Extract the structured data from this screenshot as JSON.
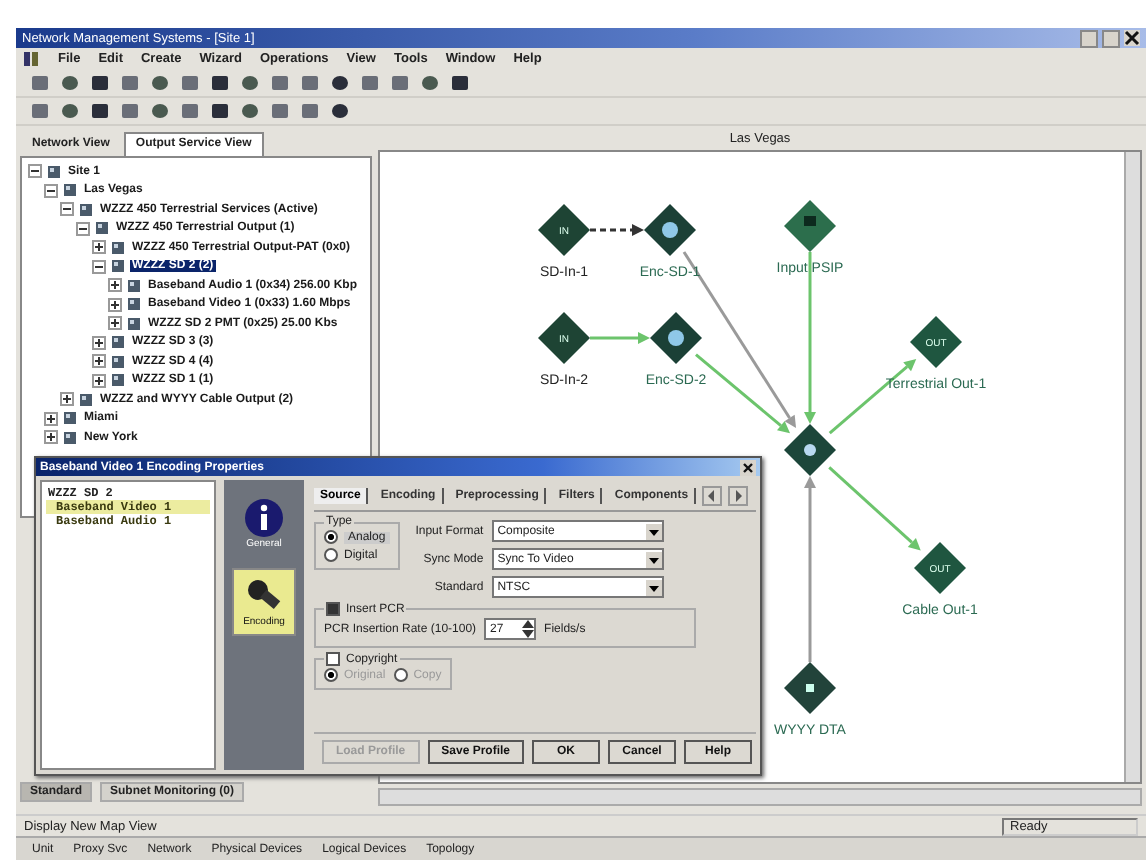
{
  "window": {
    "title": "Network Management Systems - [Site 1]"
  },
  "menu": [
    "File",
    "Edit",
    "Create",
    "Wizard",
    "Operations",
    "View",
    "Tools",
    "Window",
    "Help"
  ],
  "left_tabs": [
    {
      "label": "Network View",
      "selected": false
    },
    {
      "label": "Output Service View",
      "selected": true
    }
  ],
  "tree": [
    {
      "label": "Site 1",
      "expanded": true,
      "selected": false,
      "children": [
        {
          "label": "Las Vegas",
          "expanded": true,
          "selected": false,
          "children": [
            {
              "label": "WZZZ 450 Terrestrial Services (Active)",
              "expanded": true,
              "selected": false,
              "children": [
                {
                  "label": "WZZZ 450 Terrestrial Output (1)",
                  "expanded": true,
                  "selected": false,
                  "children": [
                    {
                      "label": "WZZZ 450 Terrestrial Output-PAT (0x0)",
                      "expanded": false,
                      "selected": false
                    },
                    {
                      "label": "WZZZ SD 2 (2)",
                      "expanded": true,
                      "selected": true,
                      "children": [
                        {
                          "label": "Baseband Audio 1 (0x34) 256.00 Kbp",
                          "expanded": false,
                          "selected": false
                        },
                        {
                          "label": "Baseband Video 1 (0x33) 1.60 Mbps",
                          "expanded": false,
                          "selected": false
                        },
                        {
                          "label": "WZZZ SD 2 PMT (0x25) 25.00 Kbs",
                          "expanded": false,
                          "selected": false
                        }
                      ]
                    },
                    {
                      "label": "WZZZ SD 3 (3)",
                      "expanded": false,
                      "selected": false
                    },
                    {
                      "label": "WZZZ SD 4 (4)",
                      "expanded": false,
                      "selected": false
                    },
                    {
                      "label": "WZZZ SD 1 (1)",
                      "expanded": false,
                      "selected": false
                    }
                  ]
                }
              ]
            },
            {
              "label": "WZZZ and WYYY Cable Output (2)",
              "expanded": false,
              "selected": false
            }
          ]
        },
        {
          "label": "Miami",
          "expanded": false,
          "selected": false
        },
        {
          "label": "New York",
          "expanded": false,
          "selected": false
        }
      ]
    }
  ],
  "left_bottom_tabs": [
    {
      "label": "Standard",
      "selected": true
    },
    {
      "label": "Subnet Monitoring (0)",
      "selected": false
    }
  ],
  "map": {
    "title": "Las Vegas",
    "nodes": [
      {
        "kind": "input",
        "label": "SD-In-1",
        "badge": "IN"
      },
      {
        "kind": "encoder",
        "label": "Enc-SD-1"
      },
      {
        "kind": "psip",
        "label": "Input PSIP"
      },
      {
        "kind": "input",
        "label": "SD-In-2",
        "badge": "IN"
      },
      {
        "kind": "encoder",
        "label": "Enc-SD-2"
      },
      {
        "kind": "output",
        "label": "Terrestrial Out-1",
        "badge": "OUT"
      },
      {
        "kind": "mux"
      },
      {
        "kind": "output",
        "label": "Cable Out-1",
        "badge": "OUT"
      },
      {
        "kind": "dta",
        "label": "WYYY DTA"
      }
    ],
    "links": [
      {
        "kind": "dashed"
      },
      {
        "kind": "inactive"
      },
      {
        "kind": "active"
      },
      {
        "kind": "active"
      },
      {
        "kind": "active"
      },
      {
        "kind": "active"
      },
      {
        "kind": "active"
      },
      {
        "kind": "inactive"
      }
    ]
  },
  "dialog": {
    "title": "Baseband Video 1 Encoding Properties",
    "items": [
      {
        "label": "WZZZ SD 2",
        "selected": false
      },
      {
        "label": "Baseband Video 1",
        "selected": true
      },
      {
        "label": "Baseband Audio 1",
        "selected": false
      }
    ],
    "sections": [
      {
        "kind": "info",
        "label": "General",
        "selected": false
      },
      {
        "kind": "encoding",
        "label": "Encoding",
        "selected": true
      }
    ],
    "tabs": [
      {
        "label": "Source",
        "selected": true
      },
      {
        "label": "Encoding",
        "selected": false
      },
      {
        "label": "Preprocessing",
        "selected": false
      },
      {
        "label": "Filters",
        "selected": false
      },
      {
        "label": "Components",
        "selected": false
      }
    ],
    "type_group": {
      "label": "Type",
      "options": [
        {
          "label": "Analog",
          "selected": true
        },
        {
          "label": "Digital",
          "selected": false
        }
      ]
    },
    "fields": [
      {
        "label": "Input Format",
        "value": "Composite"
      },
      {
        "label": "Sync Mode",
        "value": "Sync To Video"
      },
      {
        "label": "Standard",
        "value": "NTSC"
      }
    ],
    "pcr": {
      "label": "Insert PCR",
      "checked": true,
      "rate_label": "PCR Insertion Rate (10-100)",
      "rate": "27",
      "unit": "Fields/s"
    },
    "copyright": {
      "label": "Copyright",
      "checked": false,
      "options": [
        {
          "label": "Original",
          "selected": true
        },
        {
          "label": "Copy",
          "selected": false
        }
      ]
    },
    "buttons": [
      {
        "label": "Load Profile",
        "disabled": true
      },
      {
        "label": "Save Profile",
        "disabled": false
      },
      {
        "label": "OK",
        "disabled": false
      },
      {
        "label": "Cancel",
        "disabled": false
      },
      {
        "label": "Help",
        "disabled": false
      }
    ]
  },
  "status_bar": {
    "message": "Display New Map View",
    "panels": [
      "Ready"
    ]
  },
  "taskbar": [
    "Unit",
    "Proxy Svc",
    "Network",
    "Physical Devices",
    "Logical Devices",
    "Topology"
  ]
}
